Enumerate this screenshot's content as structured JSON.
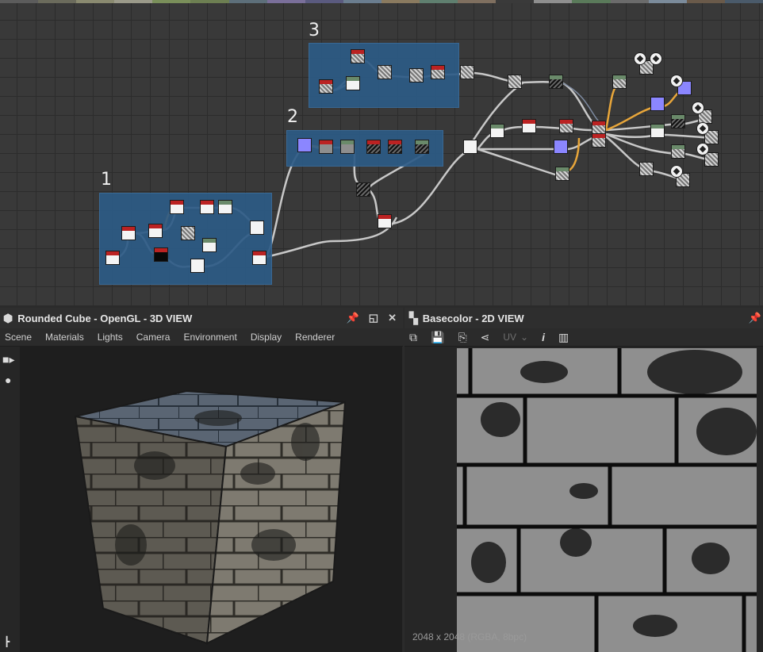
{
  "swatches": [
    "#5c5c5c",
    "#6b6b5c",
    "#8a8a70",
    "#9b9a8a",
    "#7a8f5a",
    "#6d7f52",
    "#5d6f7a",
    "#7a6f9a",
    "#5a5a7f",
    "#6a7d8f",
    "#8a7a5f",
    "#5f7f6f",
    "#7f6f5f",
    "#3a3a3a",
    "#8f8f8f",
    "#5a7a5a",
    "#6b6b6b",
    "#7b8b9b",
    "#6a5a4a",
    "#4a5a6a"
  ],
  "graph": {
    "frames": [
      {
        "label": "1"
      },
      {
        "label": "2"
      },
      {
        "label": "3"
      }
    ]
  },
  "panel3d": {
    "title": "Rounded Cube - OpenGL - 3D VIEW",
    "menu": [
      "Scene",
      "Materials",
      "Lights",
      "Camera",
      "Environment",
      "Display",
      "Renderer"
    ]
  },
  "panel2d": {
    "title": "Basecolor - 2D VIEW",
    "uv_label": "UV",
    "status": "2048 x 2048 (RGBA, 8bpc)"
  }
}
